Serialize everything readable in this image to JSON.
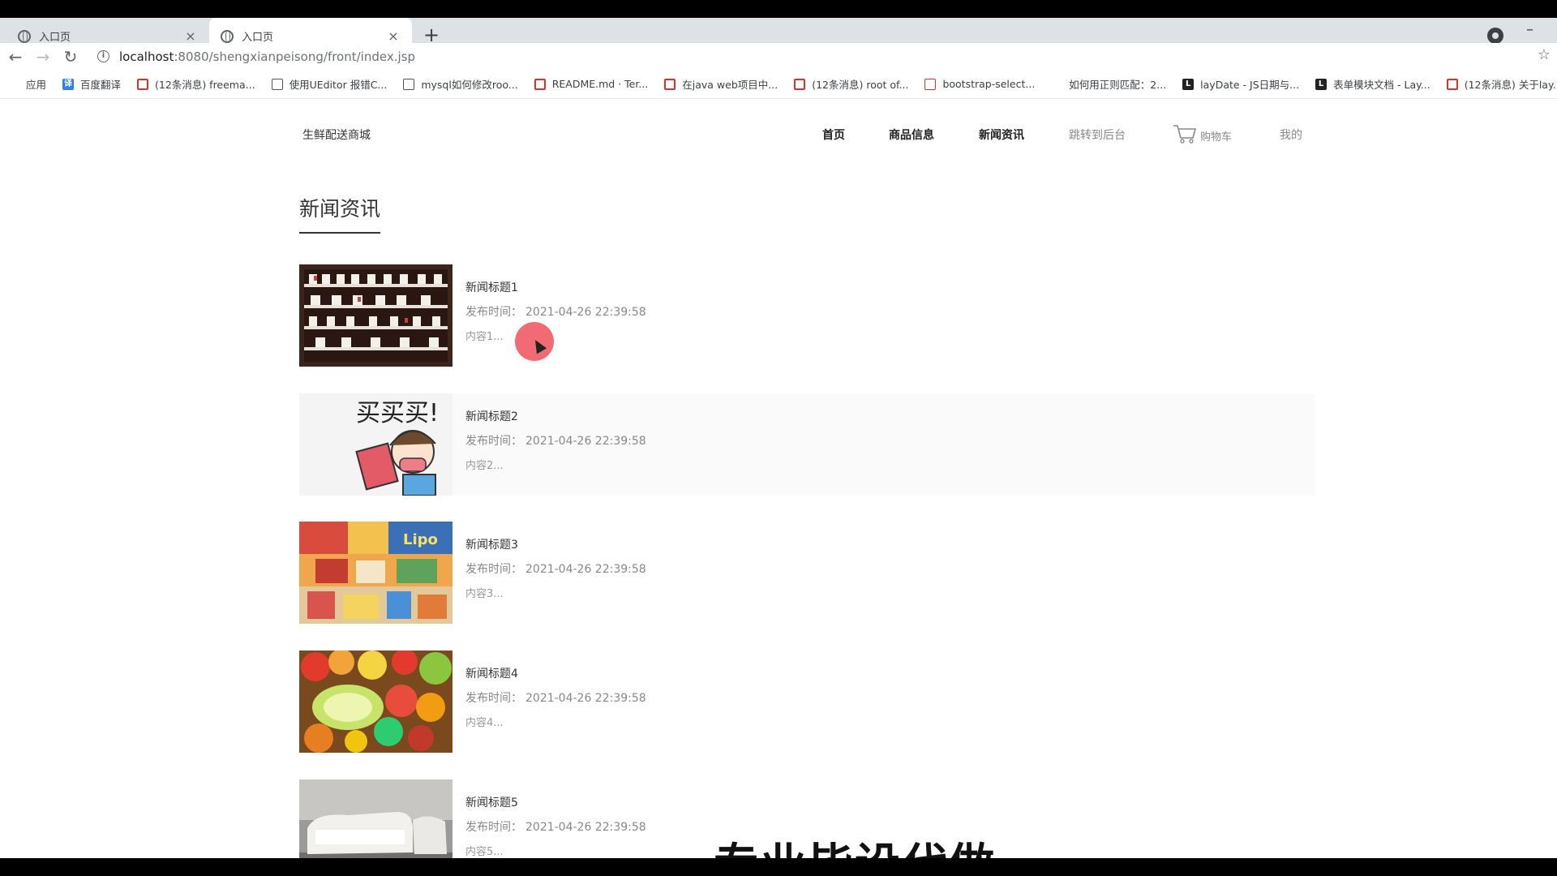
{
  "browser": {
    "tabs": [
      {
        "title": "入口页",
        "close": "×",
        "active": false
      },
      {
        "title": "入口页",
        "close": "×",
        "active": true
      }
    ],
    "new_tab": "+",
    "minimize": "–",
    "url_host": "localhost",
    "url_rest": ":8080/shengxianpeisong/front/index.jsp",
    "bookmarks": [
      {
        "icon": "apps-grid-icon",
        "label": "应用"
      },
      {
        "icon": "baidu-translate-icon",
        "label": "百度翻译"
      },
      {
        "icon": "csdn-icon",
        "label": "(12条消息) freema..."
      },
      {
        "icon": "ueditor-icon",
        "label": "使用UEditor 报错C..."
      },
      {
        "icon": "mysql-icon",
        "label": "mysql如何修改roo..."
      },
      {
        "icon": "gitee-icon",
        "label": "README.md · Ter..."
      },
      {
        "icon": "csdn-icon",
        "label": "在java web项目中..."
      },
      {
        "icon": "csdn-icon",
        "label": "(12条消息) root of..."
      },
      {
        "icon": "bootstrap-icon",
        "label": "bootstrap-select..."
      },
      {
        "icon": "baidu-paw-icon",
        "label": "如何用正则匹配：2..."
      },
      {
        "icon": "layui-icon",
        "label": "layDate - JS日期与..."
      },
      {
        "icon": "layui-icon",
        "label": "表单模块文档 - Lay..."
      },
      {
        "icon": "csdn-icon",
        "label": "(12条消息) 关于lay..."
      }
    ]
  },
  "header": {
    "brand": "生鲜配送商城",
    "nav": {
      "home": "首页",
      "goods": "商品信息",
      "news": "新闻资讯",
      "admin": "跳转到后台",
      "cart": "购物车",
      "mine": "我的"
    }
  },
  "section": {
    "title": "新闻资讯"
  },
  "news": [
    {
      "title": "新闻标题1",
      "date_label": "发布时间：",
      "date": "2021-04-26 22:39:58",
      "content": "内容1...",
      "image": "shoe-rack"
    },
    {
      "title": "新闻标题2",
      "date_label": "发布时间：",
      "date": "2021-04-26 22:39:58",
      "content": "内容2...",
      "image": "cartoon-shopping"
    },
    {
      "title": "新闻标题3",
      "date_label": "发布时间：",
      "date": "2021-04-26 22:39:58",
      "content": "内容3...",
      "image": "snacks-shelf"
    },
    {
      "title": "新闻标题4",
      "date_label": "发布时间：",
      "date": "2021-04-26 22:39:58",
      "content": "内容4...",
      "image": "fruit-basket"
    },
    {
      "title": "新闻标题5",
      "date_label": "发布时间：",
      "date": "2021-04-26 22:39:58",
      "content": "内容5...",
      "image": "white-sofa"
    }
  ],
  "overlay_text": "专业毕设代做",
  "colors": {
    "accent": "#333333",
    "muted": "#888888",
    "cursor": "#f0505a"
  }
}
